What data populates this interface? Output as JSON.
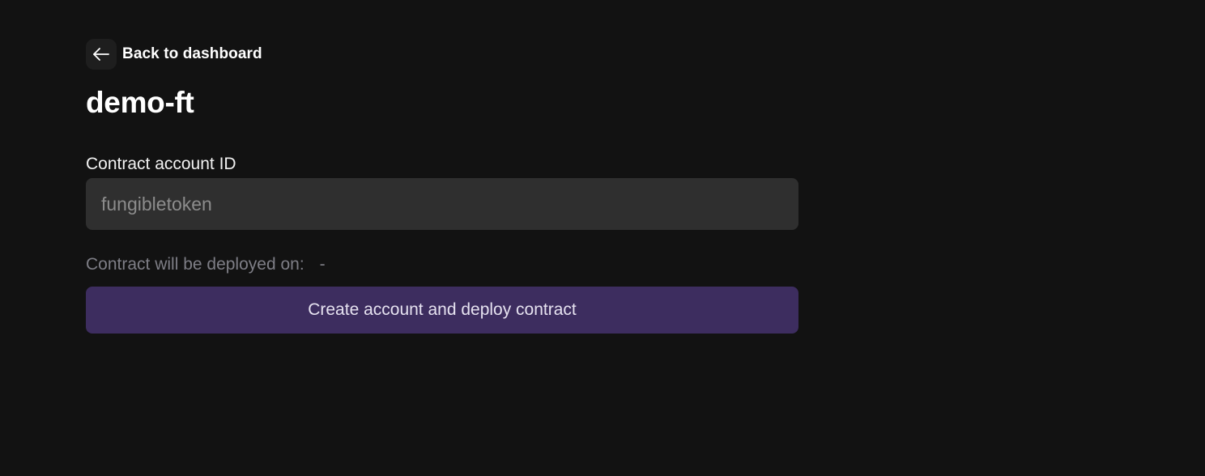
{
  "nav": {
    "back_label": "Back to dashboard",
    "back_icon": "arrow-left-icon"
  },
  "page": {
    "title": "demo-ft"
  },
  "form": {
    "contract_label": "Contract account ID",
    "contract_placeholder": "fungibletoken",
    "contract_value": "",
    "deploy_prefix": "Contract will be deployed on:",
    "deploy_value": "-",
    "submit_label": "Create account and deploy contract"
  },
  "colors": {
    "background": "#121212",
    "input_background": "#2f2f2f",
    "button_background": "#3d2d5f",
    "muted_text": "#7e7e86"
  }
}
